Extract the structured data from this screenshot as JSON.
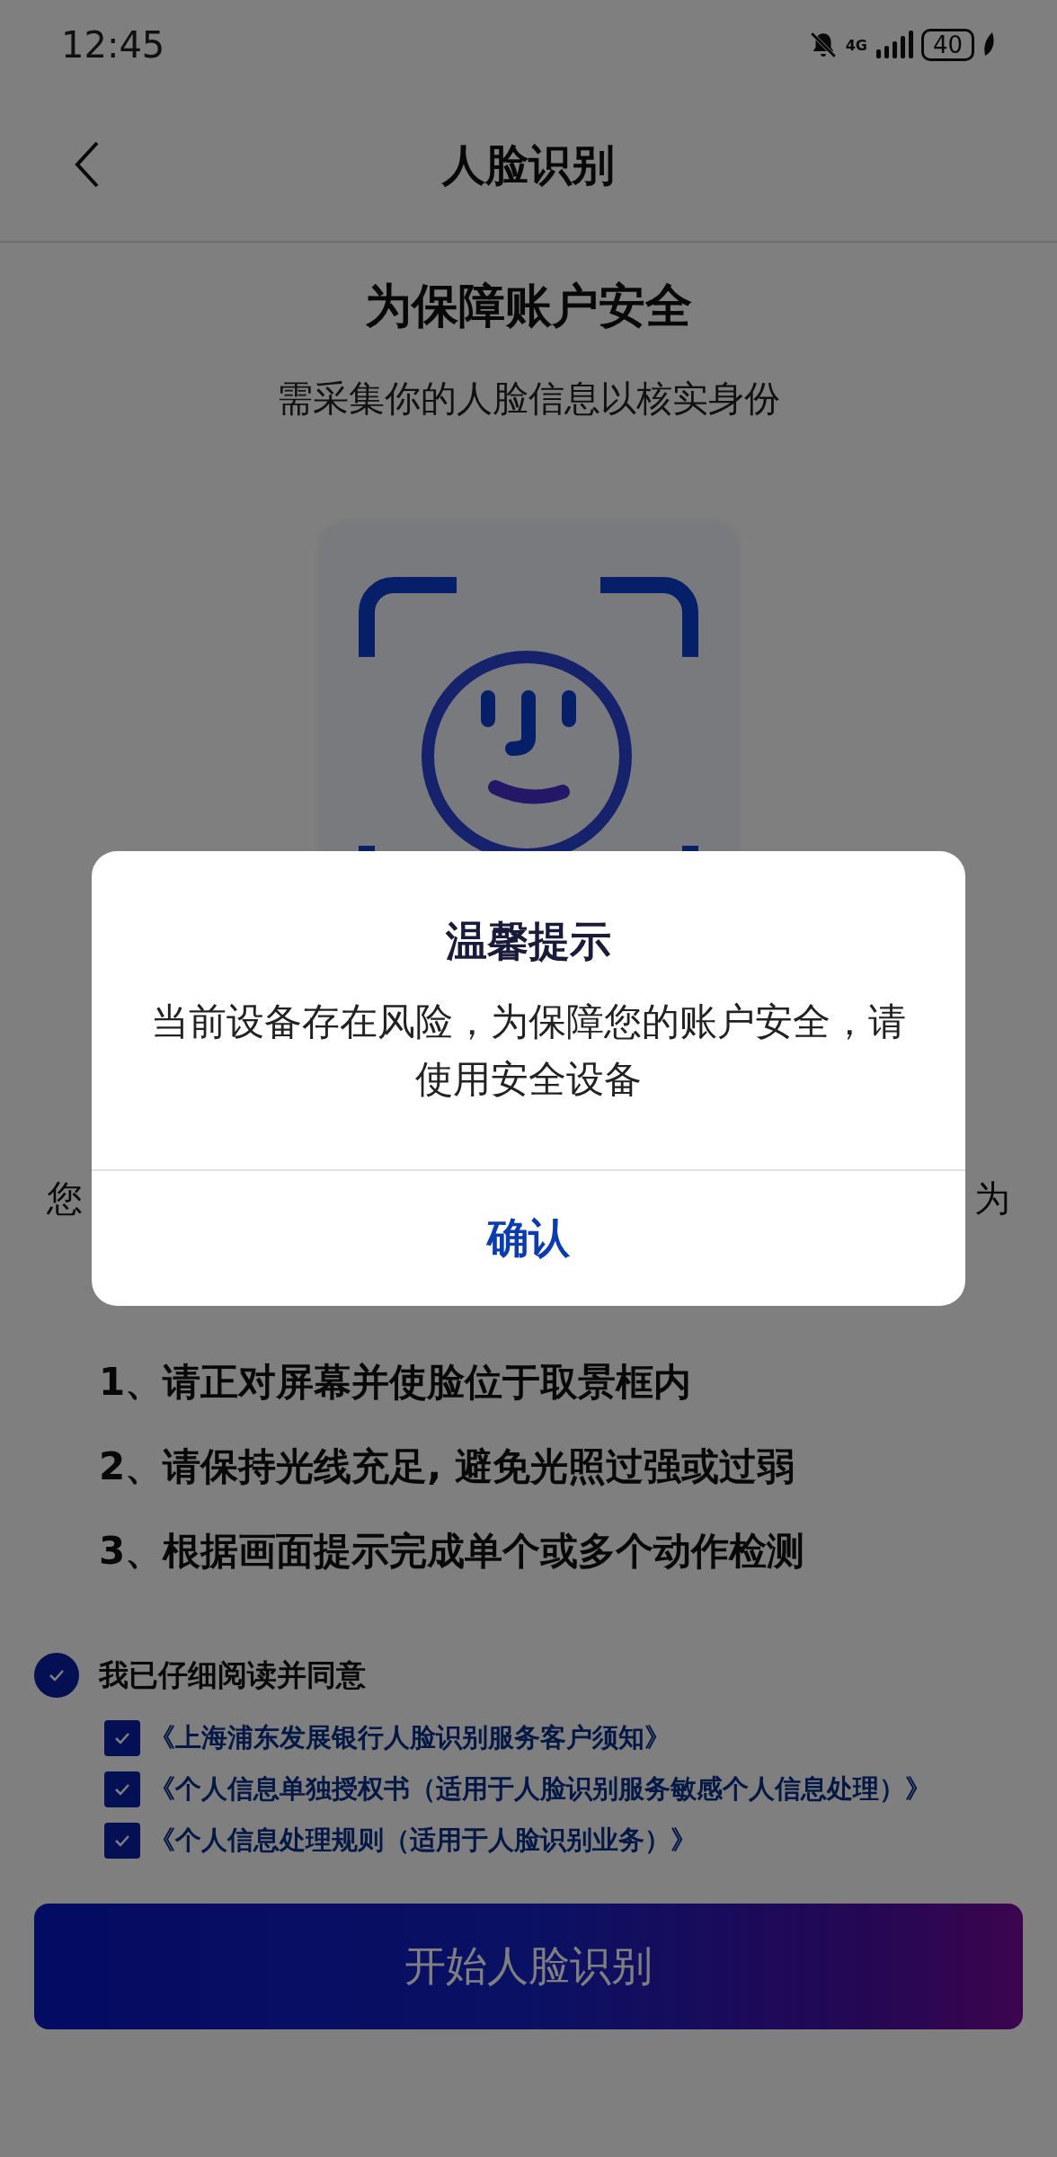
{
  "status_bar": {
    "time": "12:45",
    "network": "4G",
    "battery": "40"
  },
  "nav": {
    "title": "人脸识别"
  },
  "heading": "为保障账户安全",
  "subheading": "需采集你的人脸信息以核实身份",
  "notice_fragments": [
    "您",
    "为"
  ],
  "instructions": [
    "1、请正对屏幕并使脸位于取景框内",
    "2、请保持光线充足, 避免光照过强或过弱",
    "3、根据画面提示完成单个或多个动作检测"
  ],
  "agreement": {
    "label": "我已仔细阅读并同意",
    "checked": true,
    "documents": [
      {
        "title": "《上海浦东发展银行人脸识别服务客户须知》",
        "checked": true
      },
      {
        "title": "《个人信息单独授权书（适用于人脸识别服务敏感个人信息处理）》",
        "checked": true
      },
      {
        "title": "《个人信息处理规则（适用于人脸识别业务）》",
        "checked": true
      }
    ]
  },
  "start_button": "开始人脸识别",
  "dialog": {
    "title": "温馨提示",
    "message": "当前设备存在风险，为保障您的账户安全，请使用安全设备",
    "confirm": "确认"
  }
}
